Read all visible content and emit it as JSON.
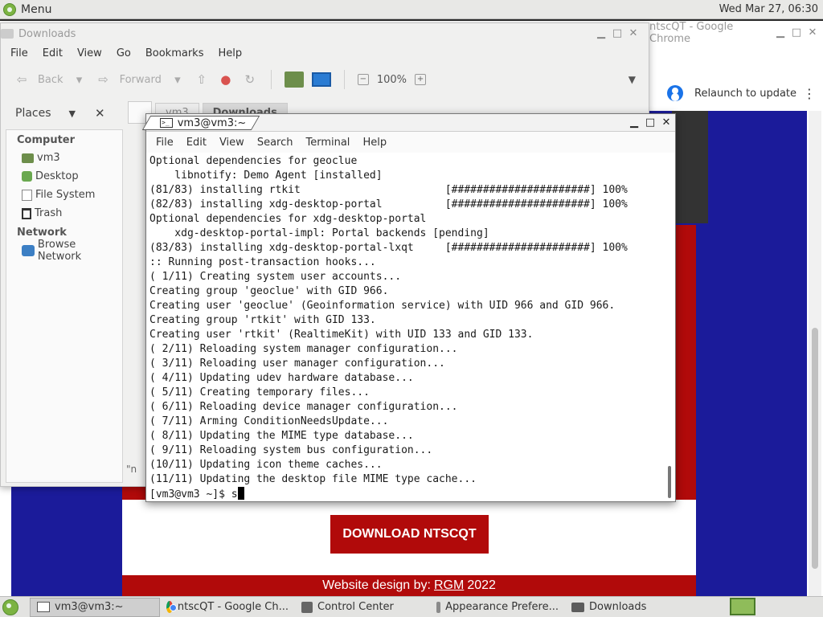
{
  "top_panel": {
    "menu_label": "Menu",
    "clock": "Wed Mar 27, 06:30"
  },
  "chrome": {
    "title_folder": "Downloads",
    "title": "ntscQT - Google Chrome",
    "relaunch": "Relaunch to update",
    "download_button": "DOWNLOAD NTSCQT",
    "footer_prefix": "Website design by:",
    "footer_link": "RGM",
    "footer_year": "2022"
  },
  "file_manager": {
    "title": "Downloads",
    "menu": [
      "File",
      "Edit",
      "View",
      "Go",
      "Bookmarks",
      "Help"
    ],
    "toolbar": {
      "back": "Back",
      "forward": "Forward",
      "zoom": "100%"
    },
    "places_label": "Places",
    "sidebar": {
      "computer_header": "Computer",
      "computer_items": [
        "vm3",
        "Desktop",
        "File System",
        "Trash"
      ],
      "network_header": "Network",
      "network_items": [
        "Browse Network"
      ]
    },
    "path": [
      "vm3",
      "Downloads"
    ],
    "status_fragment": "\"n"
  },
  "terminal": {
    "title": "vm3@vm3:~",
    "menu": [
      "File",
      "Edit",
      "View",
      "Search",
      "Terminal",
      "Help"
    ],
    "lines": [
      "Optional dependencies for geoclue",
      "    libnotify: Demo Agent [installed]",
      "(81/83) installing rtkit                       [######################] 100%",
      "(82/83) installing xdg-desktop-portal          [######################] 100%",
      "Optional dependencies for xdg-desktop-portal",
      "    xdg-desktop-portal-impl: Portal backends [pending]",
      "(83/83) installing xdg-desktop-portal-lxqt     [######################] 100%",
      ":: Running post-transaction hooks...",
      "( 1/11) Creating system user accounts...",
      "Creating group 'geoclue' with GID 966.",
      "Creating user 'geoclue' (Geoinformation service) with UID 966 and GID 966.",
      "Creating group 'rtkit' with GID 133.",
      "Creating user 'rtkit' (RealtimeKit) with UID 133 and GID 133.",
      "( 2/11) Reloading system manager configuration...",
      "( 3/11) Reloading user manager configuration...",
      "( 4/11) Updating udev hardware database...",
      "( 5/11) Creating temporary files...",
      "( 6/11) Reloading device manager configuration...",
      "( 7/11) Arming ConditionNeedsUpdate...",
      "( 8/11) Updating the MIME type database...",
      "( 9/11) Reloading system bus configuration...",
      "(10/11) Updating icon theme caches...",
      "(11/11) Updating the desktop file MIME type cache..."
    ],
    "prompt": "[vm3@vm3 ~]$ ",
    "typed": "s"
  },
  "taskbar": {
    "tasks": [
      "vm3@vm3:~",
      "ntscQT - Google Ch...",
      "Control Center",
      "Appearance Prefere...",
      "Downloads"
    ]
  }
}
